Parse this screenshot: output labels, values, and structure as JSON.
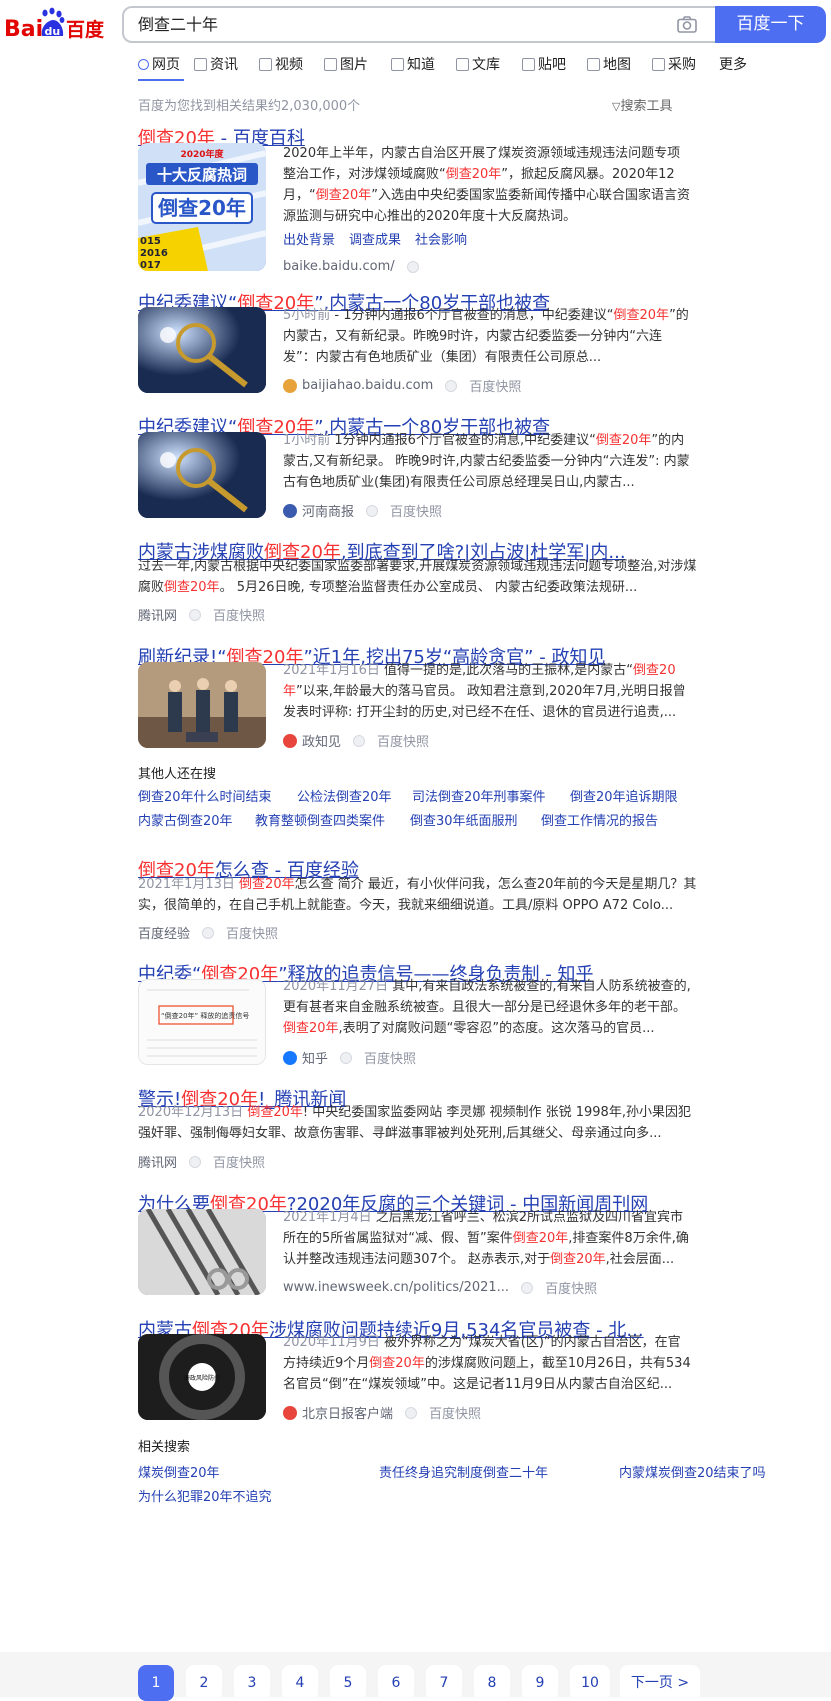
{
  "header": {
    "logo_text_left": "Bai",
    "logo_text_du": "du",
    "logo_text_right": "百度",
    "query": "倒查二十年",
    "search_button": "百度一下"
  },
  "tabs": [
    "网页",
    "资讯",
    "视频",
    "图片",
    "知道",
    "文库",
    "贴吧",
    "地图",
    "采购",
    "更多"
  ],
  "result_count": "百度为您找到相关结果约2,030,000个",
  "search_tools": "搜索工具",
  "results": [
    {
      "title_pre": "",
      "title_em": "倒查20年",
      "title_post": " - 百度百科",
      "snippet_html": "2020年上半年，内蒙古自治区开展了煤炭资源领域违规违法问题专项整治工作，对涉煤领域腐败“<em>倒查20年</em>”，掀起反腐风暴。2020年12月，“<em>倒查20年</em>”入选由中央纪委国家监委新闻传播中心联合国家语言资源监测与研究中心推出的2020年度十大反腐热词。",
      "sublinks": [
        "出处背景",
        "调查成果",
        "社会影响"
      ],
      "source": "baike.baidu.com/",
      "thumb_text": "倒查20年",
      "thumb_top": "2020年度",
      "thumb_banner": "十大反腐热词",
      "thumb_years": [
        "015",
        "2016",
        "017"
      ]
    },
    {
      "title_pre": "中纪委建议“",
      "title_em": "倒查20年",
      "title_post": "”,内蒙古一个80岁干部也被查",
      "time": "5小时前",
      "snippet_html": " - 1分钟内通报6个厅官被查的消息，中纪委建议“<em>倒查20年</em>”的内蒙古，又有新纪录。昨晚9时许，内蒙古纪委监委一分钟内“六连发”：内蒙古有色地质矿业（集团）有限责任公司原总...",
      "source": "baijiahao.baidu.com",
      "kuaizhao": "百度快照"
    },
    {
      "title_pre": "中纪委建议“",
      "title_em": "倒查20年",
      "title_post": "”,内蒙古一个80岁干部也被查",
      "time": "1小时前",
      "snippet_html": " 1分钟内通报6个厅官被查的消息,中纪委建议“<em>倒查20年</em>”的内蒙古,又有新纪录。 昨晚9时许,内蒙古纪委监委一分钟内“六连发”: 内蒙古有色地质矿业(集团)有限责任公司原总经理吴日山,内蒙古...",
      "source": "河南商报",
      "kuaizhao": "百度快照"
    },
    {
      "title_pre": "内蒙古涉煤腐败",
      "title_em": "倒查20年",
      "title_post": ",到底查到了啥?|刘占波|杜学军|内...",
      "snippet_html": "过去一年,内蒙古根据中央纪委国家监委部署要求,开展煤炭资源领域违规违法问题专项整治,对涉煤腐败<em>倒查20年</em>。 5月26日晚, 专项整治监督责任办公室成员、 内蒙古纪委政策法规研...",
      "source": "腾讯网",
      "kuaizhao": "百度快照"
    },
    {
      "title_pre": "刷新纪录!“",
      "title_em": "倒查20年",
      "title_post": "”近1年,挖出75岁“高龄贪官” - 政知见",
      "time": "2021年1月16日",
      "snippet_html": " 值得一提的是,此次落马的王振林,是内蒙古“<em>倒查20年</em>”以来,年龄最大的落马官员。 政知君注意到,2020年7月,光明日报曾发表时评称: 打开尘封的历史,对已经不在任、退休的官员进行追责,...",
      "source": "政知见",
      "kuaizhao": "百度快照"
    }
  ],
  "others_search": {
    "title": "其他人还在搜",
    "row1": [
      "倒查20年什么时间结束",
      "公检法倒查20年",
      "司法倒查20年刑事案件",
      "倒查20年追诉期限"
    ],
    "row2": [
      "内蒙古倒查20年",
      "教育整顿倒查四类案件",
      "倒查30年纸面服刑",
      "倒查工作情况的报告"
    ]
  },
  "results2": [
    {
      "title_pre": "",
      "title_em": "倒查20年",
      "title_post": "怎么查 - 百度经验",
      "time": "2021年1月13日",
      "snippet_html": " <em>倒查20年</em>怎么查 简介 最近，有小伙伴问我，怎么查20年前的今天是星期几？其实，很简单的，在自己手机上就能查。今天，我就来细细说道。工具/原料 OPPO A72 Colo...",
      "source": "百度经验",
      "kuaizhao": "百度快照"
    },
    {
      "title_pre": "中纪委“",
      "title_em": "倒查20年",
      "title_post": "”释放的追责信号——终身负责制 - 知乎",
      "time": "2020年11月27日",
      "snippet_html": " 其中,有来自政法系统被查的,有来自人防系统被查的,更有甚者来自金融系统被查。且很大一部分是已经退休多年的老干部。<em>倒查20年</em>,表明了对腐败问题“零容忍”的态度。这次落马的官员...",
      "source": "知乎",
      "kuaizhao": "百度快照",
      "thumb_text": "“倒查20年” 释放的追责信号"
    },
    {
      "title_pre": "警示!",
      "title_em": "倒查20年",
      "title_post": "!_腾讯新闻",
      "time": "2020年12月13日",
      "snippet_html": " <em>倒查20年</em>! 中央纪委国家监委网站 李灵娜 视频制作 张锐 1998年,孙小果因犯强奸罪、强制侮辱妇女罪、故意伤害罪、寻衅滋事罪被判处死刑,后其继父、母亲通过向多...",
      "source": "腾讯网",
      "kuaizhao": "百度快照"
    },
    {
      "title_pre": "为什么要",
      "title_em": "倒查20年",
      "title_post": "?2020年反腐的三个关键词 - 中国新闻周刊网",
      "time": "2021年1月4日",
      "snippet_html": " 之后黑龙江省呼兰、松滨2所试点监狱及四川省宜宾市所在的5所省属监狱对“减、假、暂”案件<em>倒查20年</em>,排查案件8万余件,确认并整改违规违法问题307个。 赵赤表示,对于<em>倒查20年</em>,社会层面...",
      "source": "www.inewsweek.cn/politics/2021...",
      "kuaizhao": "百度快照"
    },
    {
      "title_pre": "内蒙古",
      "title_em": "倒查20年",
      "title_post": "涉煤腐败问题持续近9月,534名官员被查 - 北...",
      "time": "2020年11月9日",
      "snippet_html": " 被外界称之为“煤炭大省(区)”的内蒙古自治区，在官方持续近9个月<em>倒查20年</em>的涉煤腐败问题上，截至10月26日，共有534名官员“倒”在“煤炭领域”中。这是记者11月9日从内蒙古自治区纪...",
      "source": "北京日报客户端",
      "kuaizhao": "百度快照",
      "thumb_text": "廉政风险防控"
    }
  ],
  "related": {
    "title": "相关搜索",
    "links": [
      "煤炭倒查20年",
      "责任终身追究制度倒查二十年",
      "内蒙煤炭倒查20结束了吗",
      "为什么犯罪20年不追究"
    ]
  },
  "pager": {
    "pages": [
      "1",
      "2",
      "3",
      "4",
      "5",
      "6",
      "7",
      "8",
      "9",
      "10"
    ],
    "current": "1",
    "next": "下一页 >"
  },
  "colors": {
    "accent": "#4e6ef2",
    "link": "#2440b3",
    "highlight": "#f73131"
  }
}
